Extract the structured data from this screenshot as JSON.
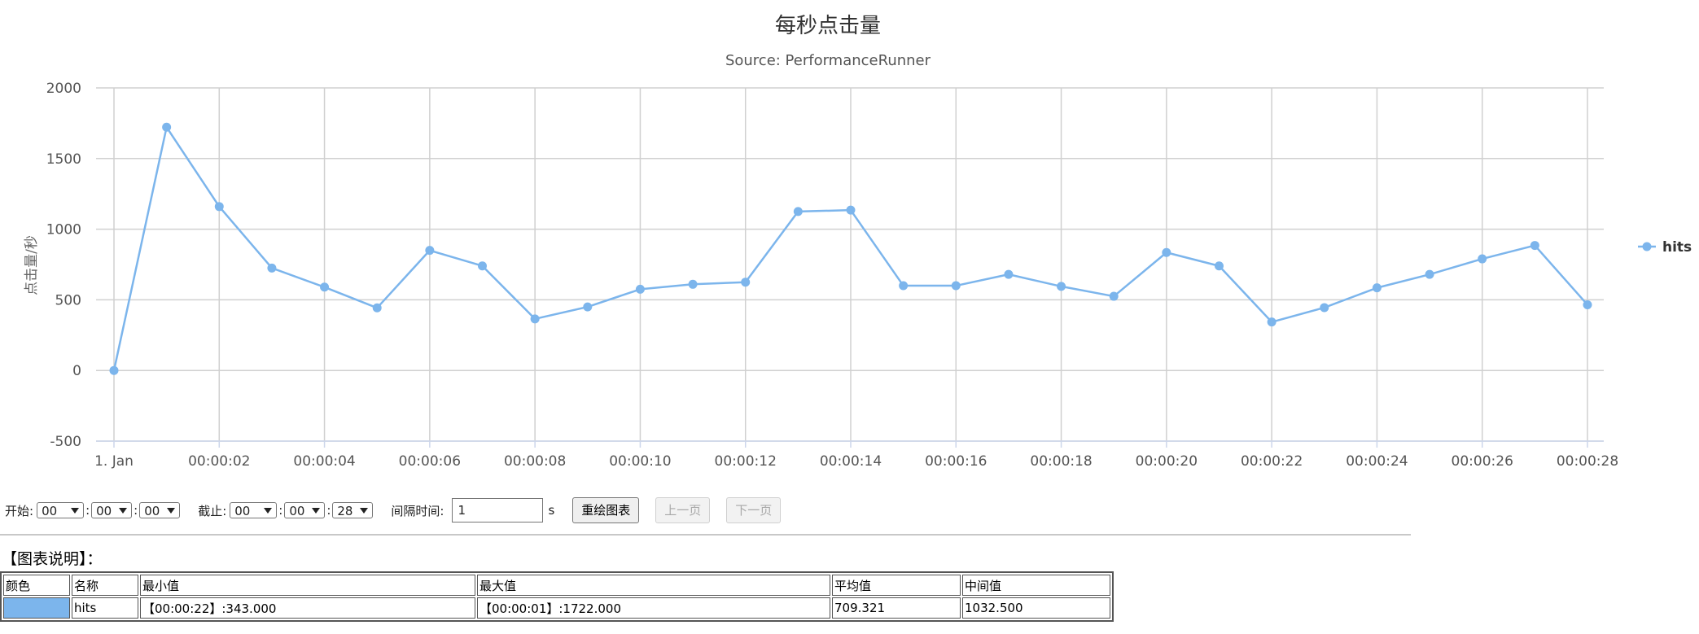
{
  "chart_data": {
    "type": "line",
    "title": "每秒点击量",
    "subtitle": "Source: PerformanceRunner",
    "ylabel": "点击量/秒",
    "xlabel": "",
    "ylim": [
      -500,
      2000
    ],
    "yticks": [
      2000,
      1500,
      1000,
      500,
      0,
      -500
    ],
    "x": [
      0,
      1,
      2,
      3,
      4,
      5,
      6,
      7,
      8,
      9,
      10,
      11,
      12,
      13,
      14,
      15,
      16,
      17,
      18,
      19,
      20,
      21,
      22,
      23,
      24,
      25,
      26,
      27,
      28
    ],
    "xticks": [
      {
        "x": 0,
        "label": "1. Jan"
      },
      {
        "x": 2,
        "label": "00:00:02"
      },
      {
        "x": 4,
        "label": "00:00:04"
      },
      {
        "x": 6,
        "label": "00:00:06"
      },
      {
        "x": 8,
        "label": "00:00:08"
      },
      {
        "x": 10,
        "label": "00:00:10"
      },
      {
        "x": 12,
        "label": "00:00:12"
      },
      {
        "x": 14,
        "label": "00:00:14"
      },
      {
        "x": 16,
        "label": "00:00:16"
      },
      {
        "x": 18,
        "label": "00:00:18"
      },
      {
        "x": 20,
        "label": "00:00:20"
      },
      {
        "x": 22,
        "label": "00:00:22"
      },
      {
        "x": 24,
        "label": "00:00:24"
      },
      {
        "x": 26,
        "label": "00:00:26"
      },
      {
        "x": 28,
        "label": "00:00:28"
      }
    ],
    "grid": true,
    "legend_position": "right",
    "series": [
      {
        "name": "hits",
        "color": "#7cb5ec",
        "values": [
          0,
          1722,
          1160,
          725,
          590,
          443,
          850,
          740,
          365,
          450,
          575,
          610,
          625,
          1125,
          1135,
          600,
          600,
          680,
          595,
          525,
          835,
          740,
          343,
          445,
          585,
          680,
          790,
          885,
          465
        ]
      }
    ]
  },
  "controls": {
    "start_label": "开始:",
    "start_h": "00",
    "start_m": "00",
    "start_s": "00",
    "end_label": "截止:",
    "end_h": "00",
    "end_m": "00",
    "end_s": "28",
    "colon": ":",
    "interval_label": "间隔时间:",
    "interval_value": "1",
    "interval_unit": "s",
    "redraw_button": "重绘图表",
    "prev_button": "上一页",
    "next_button": "下一页"
  },
  "description": {
    "title": "【图表说明】：",
    "headers": [
      "颜色",
      "名称",
      "最小值",
      "最大值",
      "平均值",
      "中间值"
    ],
    "rows": [
      {
        "color": "#7cb5ec",
        "name": "hits",
        "min": "【00:00:22】:343.000",
        "max": "【00:00:01】:1722.000",
        "avg": "709.321",
        "median": "1032.500"
      }
    ]
  }
}
